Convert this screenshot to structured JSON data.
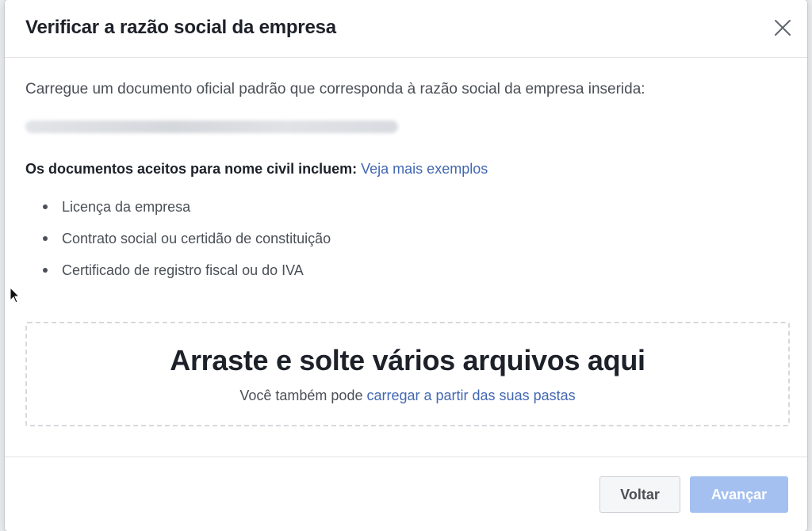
{
  "dialog": {
    "title": "Verificar a razão social da empresa",
    "close_icon": "close-icon"
  },
  "content": {
    "intro": "Carregue um documento oficial padrão que corresponda à razão social da empresa inserida:",
    "accepted_label": "Os documentos aceitos para nome civil incluem:",
    "examples_link": "Veja mais exemplos",
    "documents": [
      "Licença da empresa",
      "Contrato social ou certidão de constituição",
      "Certificado de registro fiscal ou do IVA"
    ]
  },
  "dropzone": {
    "title": "Arraste e solte vários arquivos aqui",
    "subtitle_prefix": "Você também pode",
    "subtitle_link": "carregar a partir das suas pastas"
  },
  "footer": {
    "back_label": "Voltar",
    "next_label": "Avançar"
  },
  "colors": {
    "link": "#4267b2",
    "primary_disabled": "#a3c0f0",
    "title_text": "#1d2129",
    "body_text": "#4b4f56"
  }
}
